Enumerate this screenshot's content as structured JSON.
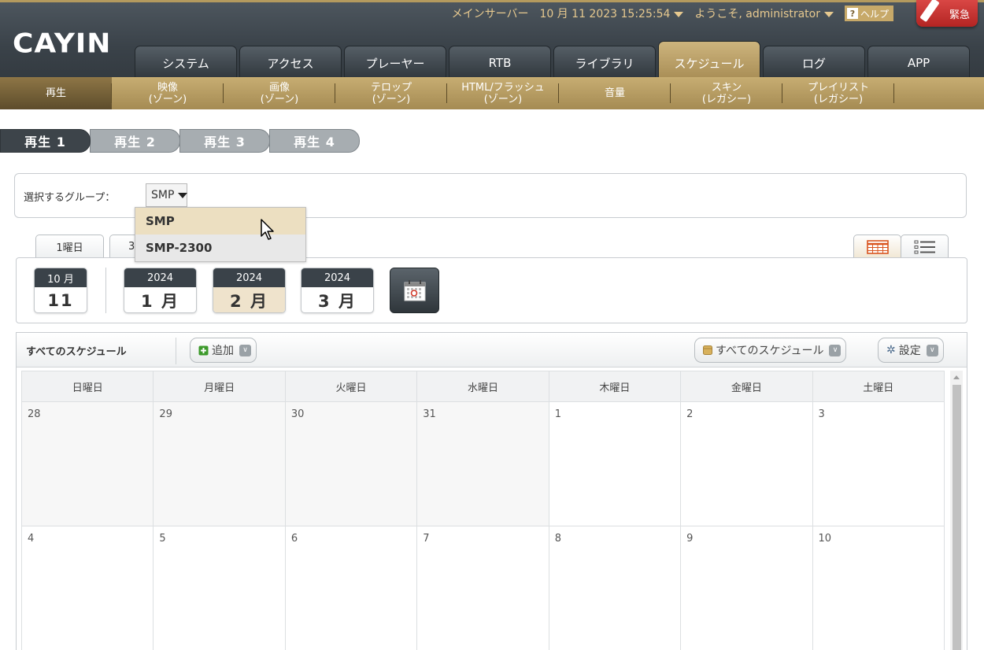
{
  "header": {
    "logo": "CAYIN",
    "server": "メインサーバー",
    "datetime": "10 月 11 2023 15:25:54",
    "welcome": "ようこそ, administrator",
    "help": "ヘルプ",
    "emergency": "緊急"
  },
  "main_tabs": [
    "システム",
    "アクセス",
    "プレーヤー",
    "RTB",
    "ライブラリ",
    "スケジュール",
    "ログ",
    "APP"
  ],
  "sub_tabs": [
    "再生",
    "映像\n(ゾーン)",
    "画像\n(ゾーン)",
    "テロップ\n(ゾーン)",
    "HTML/フラッシュ\n(ゾーン)",
    "音量",
    "スキン\n(レガシー)",
    "プレイリスト\n(レガシー)"
  ],
  "play_tabs": [
    "再生 1",
    "再生 2",
    "再生 3",
    "再生 4"
  ],
  "group": {
    "label": "選択するグループ：",
    "selected": "SMP",
    "options": [
      "SMP",
      "SMP-2300"
    ]
  },
  "view_tabs": [
    "1曜日",
    "3"
  ],
  "date_cards": [
    {
      "top": "10 月",
      "bottom": "11"
    },
    {
      "top": "2024",
      "bottom": "1 月"
    },
    {
      "top": "2024",
      "bottom": "2 月"
    },
    {
      "top": "2024",
      "bottom": "3 月"
    }
  ],
  "toolbar": {
    "title": "すべてのスケジュール",
    "add": "追加",
    "filter": "すべてのスケジュール",
    "settings": "設定"
  },
  "calendar": {
    "weekdays": [
      "日曜日",
      "月曜日",
      "火曜日",
      "水曜日",
      "木曜日",
      "金曜日",
      "土曜日"
    ],
    "week1": [
      "28",
      "29",
      "30",
      "31",
      "1",
      "2",
      "3"
    ],
    "week2": [
      "4",
      "5",
      "6",
      "7",
      "8",
      "9",
      "10"
    ]
  },
  "colors": {
    "header_dark": "#3a4249",
    "gold": "#b49a5e",
    "accent_text": "#e7c98f",
    "emergency_red": "#c8302e"
  }
}
